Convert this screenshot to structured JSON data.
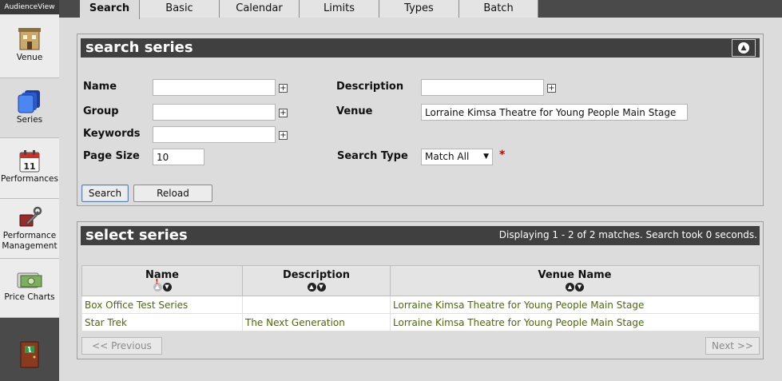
{
  "app": {
    "brand": "AudienceView"
  },
  "sidebar": {
    "items": [
      {
        "label": "Venue",
        "icon": "building-icon"
      },
      {
        "label": "Series",
        "icon": "stacked-layers-icon"
      },
      {
        "label": "Performances",
        "icon": "calendar-icon"
      },
      {
        "label_line1": "Performance",
        "label_line2": "Management",
        "icon": "wrench-icon"
      },
      {
        "label": "Price Charts",
        "icon": "cash-icon"
      }
    ],
    "exit_icon": "exit-door-icon"
  },
  "tabs": [
    "Search",
    "Basic",
    "Calendar",
    "Limits",
    "Types",
    "Batch"
  ],
  "search_panel": {
    "title": "search series",
    "labels": {
      "name": "Name",
      "description": "Description",
      "group": "Group",
      "venue": "Venue",
      "keywords": "Keywords",
      "page_size": "Page Size",
      "search_type": "Search Type"
    },
    "values": {
      "name": "",
      "description": "",
      "group": "",
      "venue": "Lorraine Kimsa Theatre for Young People Main Stage",
      "keywords": "",
      "page_size": "10",
      "search_type": "Match All"
    },
    "required_mark": "*",
    "buttons": {
      "search": "Search",
      "reload": "Reload"
    }
  },
  "results_panel": {
    "title": "select series",
    "info": "Displaying 1 - 2 of 2 matches. Search took 0 seconds.",
    "columns": [
      "Name",
      "Description",
      "Venue Name"
    ],
    "rows": [
      {
        "name": "Box Office Test Series",
        "description": "",
        "venue": "Lorraine Kimsa Theatre for Young People Main Stage"
      },
      {
        "name": "Star Trek",
        "description": "The Next Generation",
        "venue": "Lorraine Kimsa Theatre for Young People Main Stage"
      }
    ],
    "pager": {
      "previous": "<< Previous",
      "next": "Next >>"
    }
  },
  "colors": {
    "header_bg": "#404040",
    "link_green": "#4b6b00",
    "sidebar_dark": "#4a4a4a"
  }
}
